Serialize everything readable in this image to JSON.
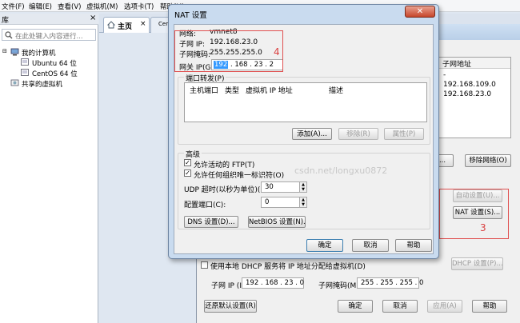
{
  "menu": {
    "items": [
      "文件(F)",
      "编辑(E)",
      "查看(V)",
      "虚拟机(M)",
      "选项卡(T)",
      "帮助(H)"
    ]
  },
  "library": {
    "header": "库",
    "close": "×",
    "search_placeholder": "在此处键入内容进行...",
    "my_computer": "我的计算机",
    "vms": [
      "Ubuntu 64 位",
      "CentOS 64 位"
    ],
    "shared": "共享的虚拟机"
  },
  "tabs": {
    "home": "主页",
    "home_close": "×",
    "partial": "Cen"
  },
  "vne": {
    "column_header": "子网地址",
    "rows": [
      "-",
      "192.168.109.0",
      "192.168.23.0"
    ],
    "btn_remove_partial": "(E)...",
    "btn_rename": "移除网络(O)",
    "btn_auto": "自动设置(U)...",
    "btn_nat": "NAT 设置(S)...",
    "dhcp_checkbox": "使用本地 DHCP 服务将 IP 地址分配给虚拟机(D)",
    "btn_dhcp": "DHCP 设置(P)...",
    "subnet_ip_label": "子网 IP (I):",
    "subnet_ip_value": "192 . 168 . 23 . 0",
    "subnet_mask_label": "子网掩码(M):",
    "subnet_mask_value": "255 . 255 . 255 . 0",
    "btn_restore": "还原默认设置(R)",
    "btn_ok": "确定",
    "btn_cancel": "取消",
    "btn_apply": "应用(A)",
    "btn_help": "帮助",
    "annotation": "3"
  },
  "nat": {
    "title": "NAT 设置",
    "network_label": "网络:",
    "network_value": "vmnet8",
    "subnet_ip_label": "子网 IP:",
    "subnet_ip_value": "192.168.23.0",
    "subnet_mask_label": "子网掩码:",
    "subnet_mask_value": "255.255.255.0",
    "gateway_label": "网关 IP(G):",
    "gateway_value": [
      "192",
      "168",
      "23",
      "2"
    ],
    "annotation": "4",
    "port_forward_title": "端口转发(P)",
    "port_columns": [
      "主机端口",
      "类型",
      "虚拟机 IP 地址",
      "描述"
    ],
    "btn_add": "添加(A)...",
    "btn_remove": "移除(R)",
    "btn_props": "属性(P)",
    "advanced_title": "高级",
    "allow_ftp": "允许活动的 FTP(T)",
    "allow_uid": "允许任何组织唯一标识符(O)",
    "udp_label": "UDP 超时(以秒为单位)(U):",
    "udp_value": "30",
    "port_label": "配置端口(C):",
    "port_value": "0",
    "btn_dns": "DNS 设置(D)...",
    "btn_netbios": "NetBIOS 设置(N)...",
    "btn_ok": "确定",
    "btn_cancel": "取消",
    "btn_help": "帮助",
    "watermark": "csdn.net/longxu0872"
  },
  "colors": {
    "annotation_red": "#e05050",
    "selection_blue": "#3399ff",
    "title_gradient_top": "#cfe0f3"
  }
}
